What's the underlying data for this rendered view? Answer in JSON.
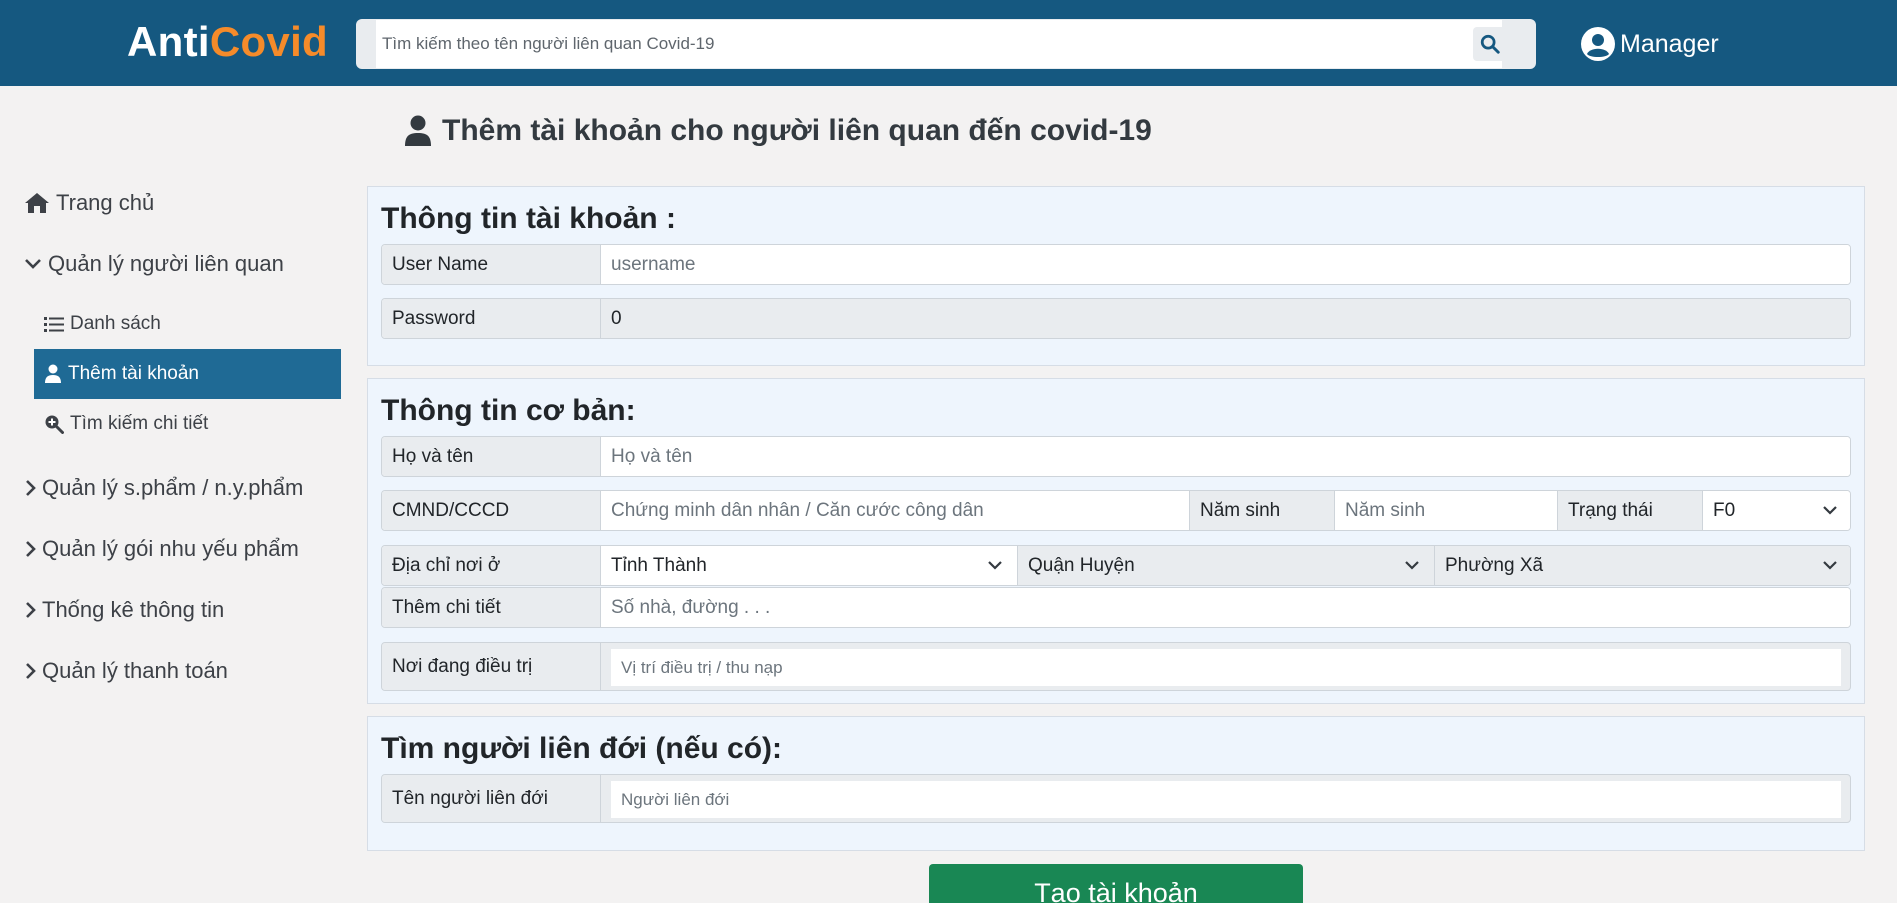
{
  "brand": {
    "part1": "Anti",
    "part2": "Covid"
  },
  "search": {
    "placeholder": "Tìm kiếm theo tên người liên quan Covid-19"
  },
  "user": {
    "name": "Manager"
  },
  "page": {
    "title": "Thêm tài khoản cho người liên quan đến covid-19"
  },
  "sidebar": {
    "home": "Trang chủ",
    "manage_related": "Quản lý người liên quan",
    "sub_list": "Danh sách",
    "sub_add": "Thêm tài khoản",
    "sub_search": "Tìm kiếm chi tiết",
    "manage_products": "Quản lý s.phẩm / n.y.phẩm",
    "manage_packages": "Quản lý gói nhu yếu phẩm",
    "statistics": "Thống kê thông tin",
    "payments": "Quản lý thanh toán"
  },
  "account": {
    "title": "Thông tin tài khoản :",
    "username_label": "User Name",
    "username_placeholder": "username",
    "password_label": "Password",
    "password_value": "0"
  },
  "basic": {
    "title": "Thông tin cơ bản:",
    "fullname_label": "Họ và tên",
    "fullname_placeholder": "Họ và tên",
    "id_label": "CMND/CCCD",
    "id_placeholder": "Chứng minh dân nhân / Căn cước công dân",
    "birth_label": "Năm sinh",
    "birth_placeholder": "Năm sinh",
    "status_label": "Trạng thái",
    "status_value": "F0",
    "address_label": "Địa chỉ nơi ở",
    "province_value": "Tỉnh Thành",
    "district_value": "Quận Huyện",
    "ward_value": "Phường Xã",
    "detail_label": "Thêm chi tiết",
    "detail_placeholder": "Số nhà, đường . . .",
    "treatment_label": "Nơi đang điều trị",
    "treatment_placeholder": "Vị trí điều trị / thu nạp"
  },
  "related": {
    "title": "Tìm người liên đới (nếu có):",
    "name_label": "Tên người liên đới",
    "name_placeholder": "Người liên đới"
  },
  "submit": {
    "label": "Tạo tài khoản"
  },
  "colors": {
    "topbar": "#155880",
    "brand_accent": "#f58b2a",
    "active_nav": "#1f6a95",
    "panel_bg": "#eef5fd",
    "submit": "#198754"
  }
}
